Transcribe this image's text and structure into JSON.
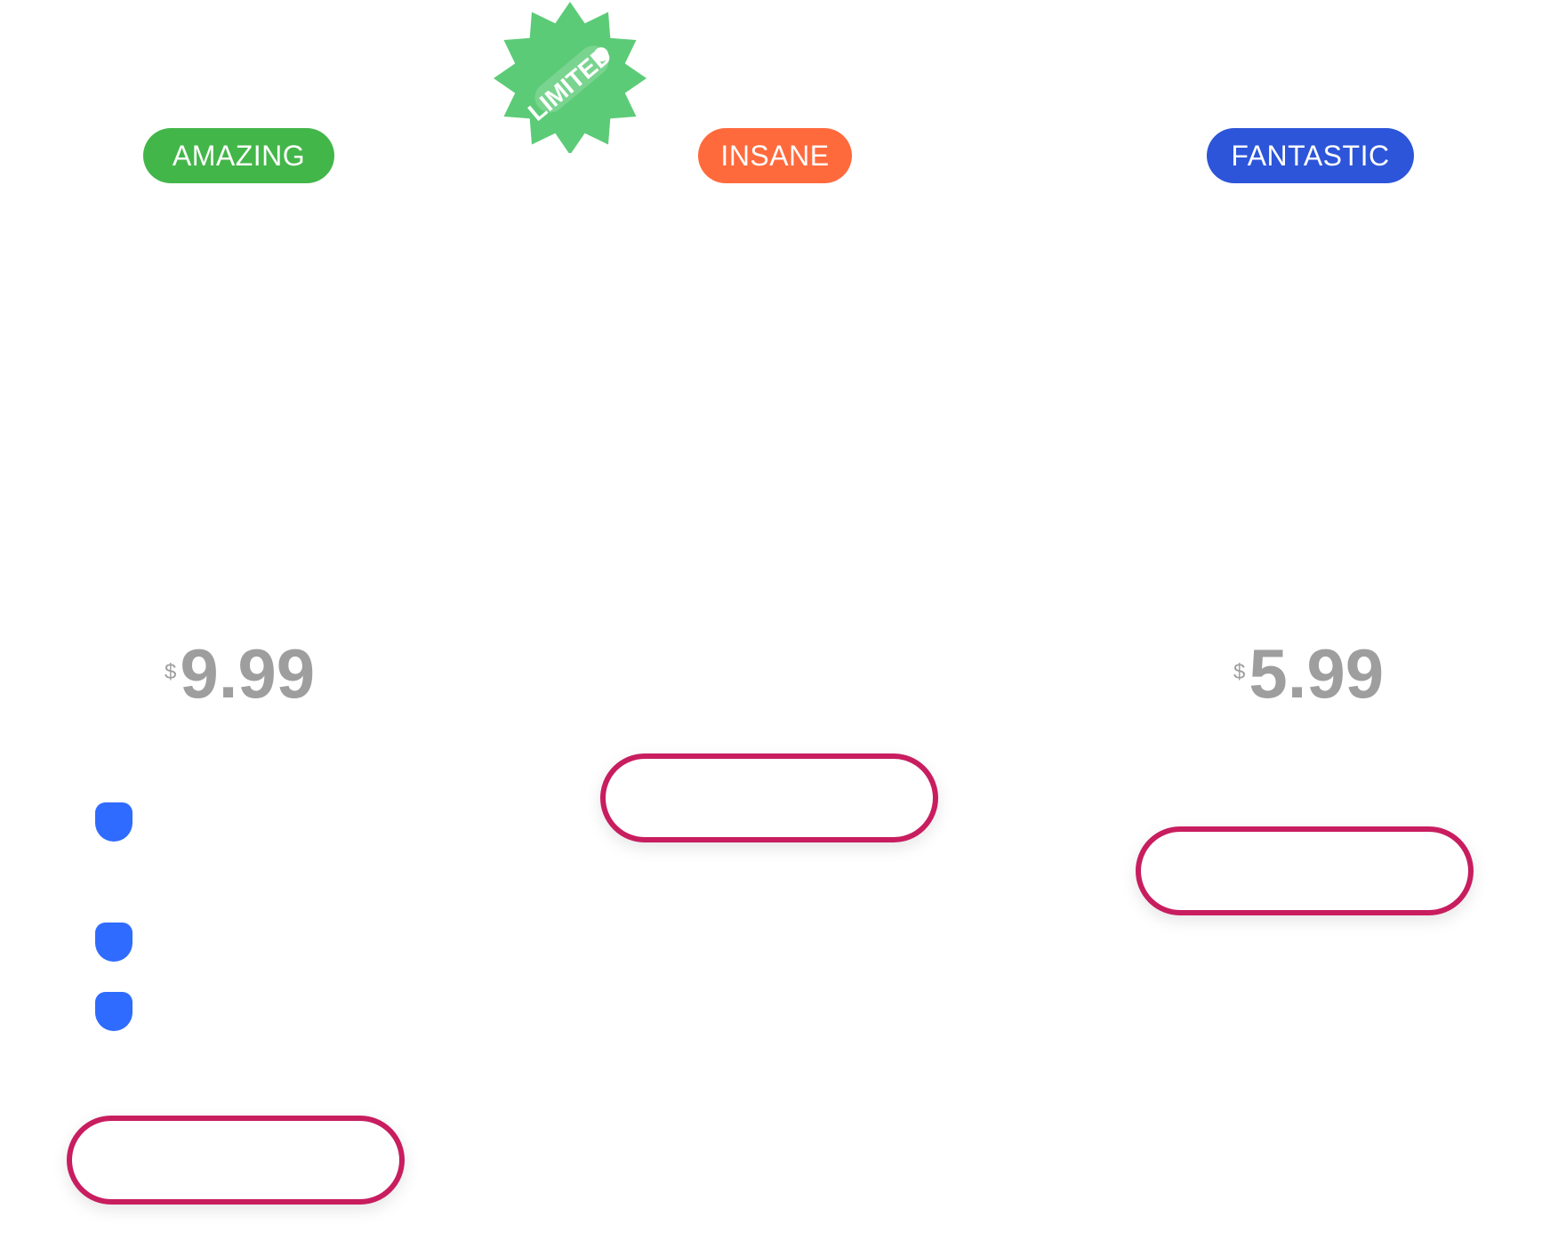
{
  "plans": [
    {
      "badge": "AMAZING",
      "badge_color": "#43b649",
      "price_currency": "$",
      "price_amount": "9.99",
      "cta_label": "",
      "feature_bullet_count": 3
    },
    {
      "badge": "INSANE",
      "badge_color": "#ff6a3d",
      "ribbon": "LIMITED",
      "ribbon_color": "#5ccb77",
      "cta_label": ""
    },
    {
      "badge": "FANTASTIC",
      "badge_color": "#2d55d9",
      "price_currency": "$",
      "price_amount": "5.99",
      "cta_label": ""
    }
  ],
  "colors": {
    "cta_border": "#c81d5f",
    "price_text": "#9e9e9e",
    "feature_bullet": "#2f6bff"
  },
  "icons": {
    "ribbon": "starburst-badge-icon",
    "feature_bullet": "bullet-icon"
  }
}
